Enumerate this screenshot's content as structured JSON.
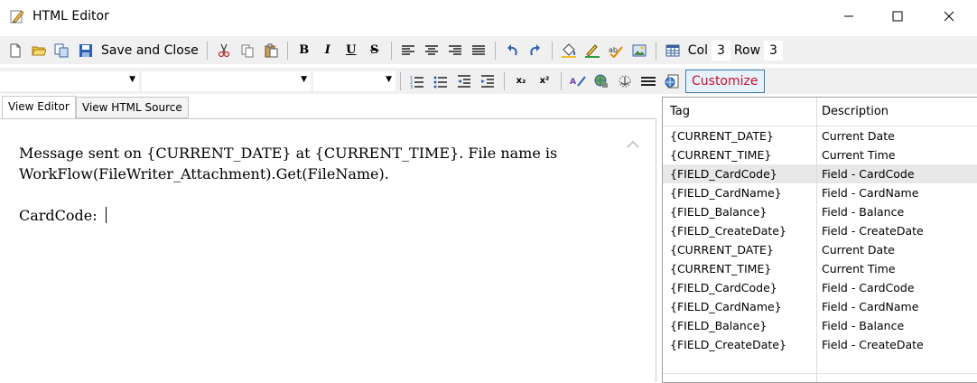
{
  "window": {
    "title": "HTML Editor",
    "minimize_symbol": "—",
    "close_symbol": "✕"
  },
  "toolbar": {
    "save_close_label": "Save and Close",
    "bold": "B",
    "italic": "I",
    "underline": "U",
    "strike": "S",
    "col_label": "Col",
    "col_value": "3",
    "row_label": "Row",
    "row_value": "3"
  },
  "format_bar": {
    "style_combo": "",
    "font_combo": "",
    "size_combo": "",
    "subscript": "x₂",
    "superscript": "x²",
    "customize_label": "Customize"
  },
  "tabs": [
    {
      "label": "View Editor",
      "active": true
    },
    {
      "label": "View HTML Source",
      "active": false
    }
  ],
  "editor": {
    "line1": "Message sent on {CURRENT_DATE} at {CURRENT_TIME}. File name is",
    "line2": "WorkFlow(FileWriter_Attachment).Get(FileName).",
    "line3": "CardCode: "
  },
  "tag_grid": {
    "header_tag": "Tag",
    "header_description": "Description",
    "selected_row": 2,
    "rows": [
      {
        "tag": "{CURRENT_DATE}",
        "description": "Current Date"
      },
      {
        "tag": "{CURRENT_TIME}",
        "description": "Current Time"
      },
      {
        "tag": "{FIELD_CardCode}",
        "description": "Field - CardCode"
      },
      {
        "tag": "{FIELD_CardName}",
        "description": "Field - CardName"
      },
      {
        "tag": "{FIELD_Balance}",
        "description": "Field - Balance"
      },
      {
        "tag": "{FIELD_CreateDate}",
        "description": "Field - CreateDate"
      },
      {
        "tag": "{CURRENT_DATE}",
        "description": "Current Date"
      },
      {
        "tag": "{CURRENT_TIME}",
        "description": "Current Time"
      },
      {
        "tag": "{FIELD_CardCode}",
        "description": "Field - CardCode"
      },
      {
        "tag": "{FIELD_CardName}",
        "description": "Field - CardName"
      },
      {
        "tag": "{FIELD_Balance}",
        "description": "Field - Balance"
      },
      {
        "tag": "{FIELD_CreateDate}",
        "description": "Field - CreateDate"
      }
    ]
  }
}
